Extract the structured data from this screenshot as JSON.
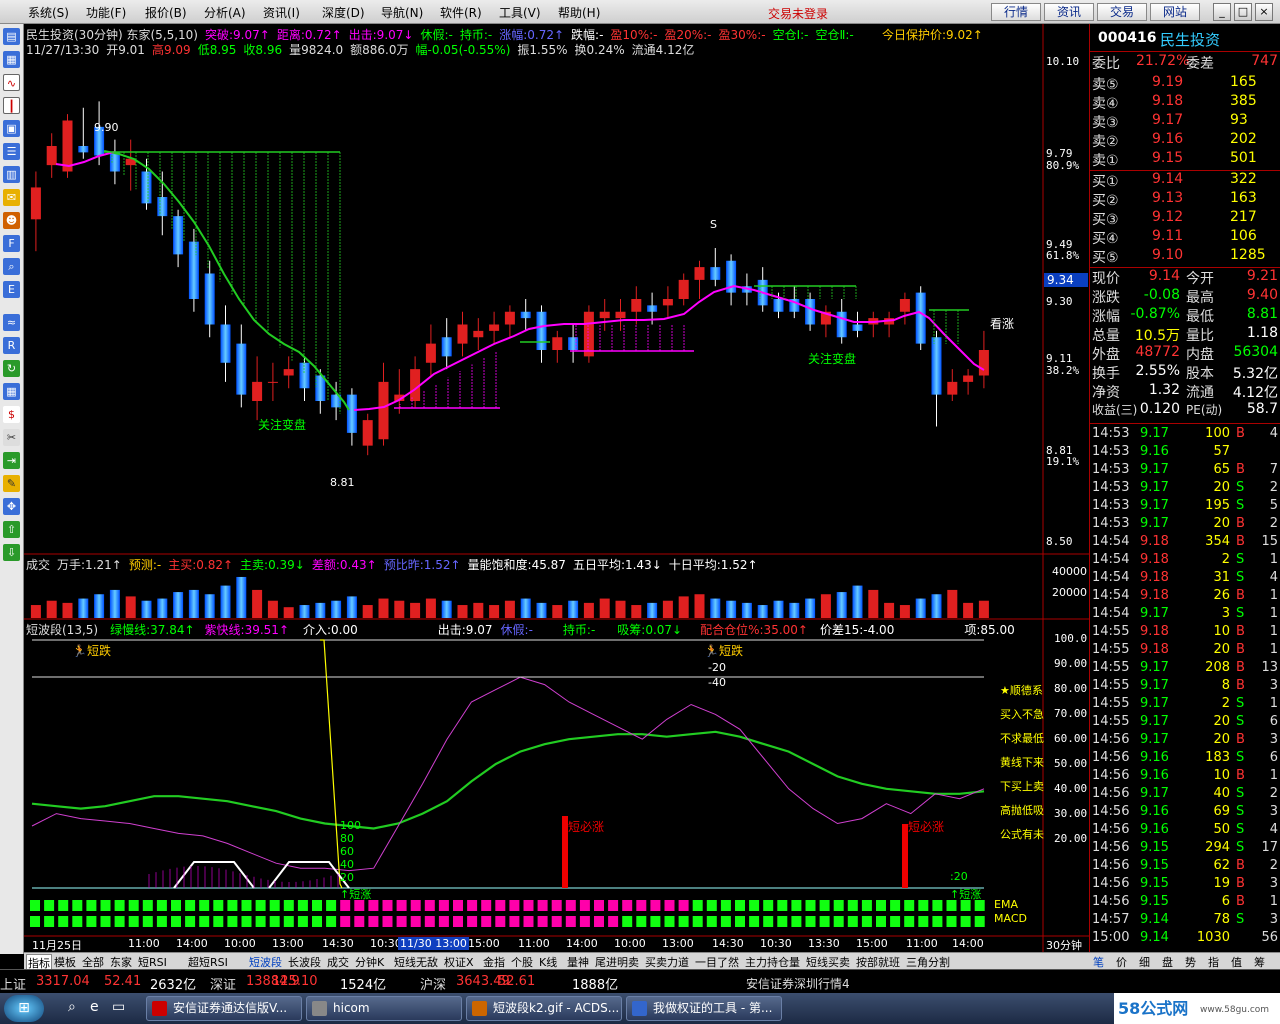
{
  "menu": {
    "items": [
      "系统(S)",
      "功能(F)",
      "报价(B)",
      "分析(A)",
      "资讯(I)",
      "深度(D)",
      "导航(N)",
      "软件(R)",
      "工具(V)",
      "帮助(H)"
    ],
    "login_status": "交易未登录",
    "buttons": [
      "行情",
      "资讯",
      "交易",
      "网站"
    ]
  },
  "window_buttons": [
    "_",
    "□",
    "×"
  ],
  "header": {
    "line1": [
      {
        "t": "民生投资(30分钟) 东家(5,5,10)",
        "c": "#ddd"
      },
      {
        "t": "突破:9.07↑",
        "c": "#f0f"
      },
      {
        "t": "距离:0.72↑",
        "c": "#f0f"
      },
      {
        "t": "出击:9.07↓",
        "c": "#f0f"
      },
      {
        "t": "休假:-",
        "c": "#0f0"
      },
      {
        "t": "持币:-",
        "c": "#0f0"
      },
      {
        "t": "涨幅:0.72↑",
        "c": "#66f"
      },
      {
        "t": "跌幅:-",
        "c": "#fff"
      },
      {
        "t": "盈10%:-",
        "c": "#f33"
      },
      {
        "t": "盈20%:-",
        "c": "#f33"
      },
      {
        "t": "盈30%:-",
        "c": "#f33"
      },
      {
        "t": "空仓Ⅰ:-",
        "c": "#0f0"
      },
      {
        "t": "空仓Ⅱ:-",
        "c": "#0f0"
      }
    ],
    "protect": "今日保护价:9.02↑",
    "line2": [
      {
        "t": "11/27/13:30",
        "c": "#ddd"
      },
      {
        "t": "开9.01",
        "c": "#ddd"
      },
      {
        "t": "高9.09",
        "c": "#f33"
      },
      {
        "t": "低8.95",
        "c": "#0f0"
      },
      {
        "t": "收8.96",
        "c": "#0f0"
      },
      {
        "t": "量9824.0",
        "c": "#ddd"
      },
      {
        "t": "额886.0万",
        "c": "#ddd"
      },
      {
        "t": "幅-0.05(-0.55%)",
        "c": "#0f0"
      },
      {
        "t": "振1.55%",
        "c": "#ddd"
      },
      {
        "t": "换0.24%",
        "c": "#ddd"
      },
      {
        "t": "流通4.12亿",
        "c": "#ddd"
      }
    ]
  },
  "price_axis": {
    "labels": [
      {
        "v": "10.10",
        "y": 38
      },
      {
        "v": "9.79",
        "y": 130
      },
      {
        "v": "80.9%",
        "y": 142
      },
      {
        "v": "9.49",
        "y": 221
      },
      {
        "v": "61.8%",
        "y": 232
      },
      {
        "v": "9.34",
        "y": 256
      },
      {
        "v": "9.30",
        "y": 278
      },
      {
        "v": "9.11",
        "y": 335
      },
      {
        "v": "38.2%",
        "y": 347
      },
      {
        "v": "8.81",
        "y": 427
      },
      {
        "v": "19.1%",
        "y": 438
      },
      {
        "v": "8.50",
        "y": 518
      }
    ],
    "current": "9.34"
  },
  "annotations": {
    "high": "9.90",
    "low": "8.81",
    "s_mark": "S",
    "watch1": "关注变盘",
    "watch2": "关注变盘",
    "kanzhang": "看涨"
  },
  "volume": {
    "header": [
      {
        "t": "成交",
        "c": "#ddd"
      },
      {
        "t": "万手:1.21↑",
        "c": "#ddd"
      },
      {
        "t": "预测:-",
        "c": "#fc0"
      },
      {
        "t": "主买:0.82↑",
        "c": "#f33"
      },
      {
        "t": "主卖:0.39↓",
        "c": "#0f0"
      },
      {
        "t": "差额:0.43↑",
        "c": "#f0f"
      },
      {
        "t": "预比昨:1.52↑",
        "c": "#66f"
      },
      {
        "t": "量能饱和度:45.87",
        "c": "#fff"
      },
      {
        "t": "五日平均:1.43↓",
        "c": "#fff"
      },
      {
        "t": "十日平均:1.52↑",
        "c": "#fff"
      }
    ],
    "axis": [
      "40000",
      "20000"
    ]
  },
  "indicator": {
    "header": [
      {
        "t": "短波段(13,5)",
        "c": "#ddd"
      },
      {
        "t": "绿慢线:37.84↑",
        "c": "#0f0"
      },
      {
        "t": "紫快线:39.51↑",
        "c": "#f0f"
      },
      {
        "t": "介入:0.00",
        "c": "#fff"
      },
      {
        "t": "出击:9.07",
        "c": "#fff"
      },
      {
        "t": "休假:-",
        "c": "#66f"
      },
      {
        "t": "持币:-",
        "c": "#0f0"
      },
      {
        "t": "吸筹:0.07↓",
        "c": "#0f0"
      },
      {
        "t": "配合仓位%:35.00↑",
        "c": "#f33"
      },
      {
        "t": "价差15:-4.00",
        "c": "#fff"
      },
      {
        "t": "项:85.00",
        "c": "#fff"
      }
    ],
    "axis": [
      "100.0",
      "90.00",
      "80.00",
      "70.00",
      "60.00",
      "50.00",
      "40.00",
      "30.00",
      "20.00"
    ],
    "legend": [
      "★顺德系",
      "买入不急",
      "不求最低",
      "黄线下来",
      "下买上卖",
      "高抛低吸",
      "公式有未"
    ],
    "labels": {
      "duandie1": "短跌",
      "duandie2": "短跌",
      "bizhang1": "短必涨",
      "bizhang2": "短必涨",
      "n100": "100",
      "n80": "80",
      "n60": "60",
      "n40": "40",
      "n20": "20",
      "m20": "-20",
      "m40": "-40",
      "duanzhang1": "短涨",
      "duanzhang2": "短涨",
      "k20": ":20",
      "ema": "EMA",
      "macd": "MACD"
    }
  },
  "time_axis": {
    "labels": [
      "11月25日",
      "11:00",
      "14:00",
      "10:00",
      "13:00",
      "14:30",
      "10:30",
      "11/30 13:00",
      "15:00",
      "11:00",
      "14:00",
      "10:00",
      "13:00",
      "14:30",
      "10:30",
      "13:30",
      "15:00",
      "11:00",
      "14:00"
    ],
    "period": "30分钟"
  },
  "bottom_tabs": [
    "指标",
    "模板",
    "全部",
    "东家",
    "短RSI",
    "超短RSI",
    "短波段",
    "长波段",
    "成交",
    "分钟K",
    "短线无敌",
    "权证X",
    "金指",
    "个股",
    "K线",
    "量神",
    "尾进明卖",
    "买卖力道",
    "一目了然",
    "主力持仓量",
    "短线买卖",
    "按部就班",
    "三角分割"
  ],
  "right_tabs": [
    "笔",
    "价",
    "细",
    "盘",
    "势",
    "指",
    "值",
    "筹"
  ],
  "quote": {
    "code": "000416",
    "name": "民生投资",
    "weibi": {
      "l": "委比",
      "v": "21.72%",
      "l2": "委差",
      "v2": "747"
    },
    "sell": [
      {
        "l": "卖⑤",
        "p": "9.19",
        "v": "165"
      },
      {
        "l": "卖④",
        "p": "9.18",
        "v": "385"
      },
      {
        "l": "卖③",
        "p": "9.17",
        "v": "93"
      },
      {
        "l": "卖②",
        "p": "9.16",
        "v": "202"
      },
      {
        "l": "卖①",
        "p": "9.15",
        "v": "501"
      }
    ],
    "buy": [
      {
        "l": "买①",
        "p": "9.14",
        "v": "322"
      },
      {
        "l": "买②",
        "p": "9.13",
        "v": "163"
      },
      {
        "l": "买③",
        "p": "9.12",
        "v": "217"
      },
      {
        "l": "买④",
        "p": "9.11",
        "v": "106"
      },
      {
        "l": "买⑤",
        "p": "9.10",
        "v": "1285"
      }
    ],
    "stats": [
      {
        "l1": "现价",
        "v1": "9.14",
        "c1": "#f33",
        "l2": "今开",
        "v2": "9.21",
        "c2": "#f33"
      },
      {
        "l1": "涨跌",
        "v1": "-0.08",
        "c1": "#0f0",
        "l2": "最高",
        "v2": "9.40",
        "c2": "#f33"
      },
      {
        "l1": "涨幅",
        "v1": "-0.87%",
        "c1": "#0f0",
        "l2": "最低",
        "v2": "8.81",
        "c2": "#0f0"
      },
      {
        "l1": "总量",
        "v1": "10.5万",
        "c1": "#ff0",
        "l2": "量比",
        "v2": "1.18",
        "c2": "#fff"
      },
      {
        "l1": "外盘",
        "v1": "48772",
        "c1": "#f33",
        "l2": "内盘",
        "v2": "56304",
        "c2": "#0f0"
      },
      {
        "l1": "换手",
        "v1": "2.55%",
        "c1": "#fff",
        "l2": "股本",
        "v2": "5.32亿",
        "c2": "#fff"
      },
      {
        "l1": "净资",
        "v1": "1.32",
        "c1": "#fff",
        "l2": "流通",
        "v2": "4.12亿",
        "c2": "#fff"
      },
      {
        "l1": "收益(三)",
        "v1": "0.120",
        "c1": "#fff",
        "l2": "PE(动)",
        "v2": "58.7",
        "c2": "#fff"
      }
    ]
  },
  "ticks": [
    [
      "14:53",
      "9.17",
      "100",
      "B",
      "4"
    ],
    [
      "14:53",
      "9.16",
      "57",
      "",
      ""
    ],
    [
      "14:53",
      "9.17",
      "65",
      "B",
      "7"
    ],
    [
      "14:53",
      "9.17",
      "20",
      "S",
      "2"
    ],
    [
      "14:53",
      "9.17",
      "195",
      "S",
      "5"
    ],
    [
      "14:53",
      "9.17",
      "20",
      "B",
      "2"
    ],
    [
      "14:54",
      "9.18",
      "354",
      "B",
      "15"
    ],
    [
      "14:54",
      "9.18",
      "2",
      "S",
      "1"
    ],
    [
      "14:54",
      "9.18",
      "31",
      "S",
      "4"
    ],
    [
      "14:54",
      "9.18",
      "26",
      "B",
      "1"
    ],
    [
      "14:54",
      "9.17",
      "3",
      "S",
      "1"
    ],
    [
      "14:55",
      "9.18",
      "10",
      "B",
      "1"
    ],
    [
      "14:55",
      "9.18",
      "20",
      "B",
      "1"
    ],
    [
      "14:55",
      "9.17",
      "208",
      "B",
      "13"
    ],
    [
      "14:55",
      "9.17",
      "8",
      "B",
      "3"
    ],
    [
      "14:55",
      "9.17",
      "2",
      "S",
      "1"
    ],
    [
      "14:55",
      "9.17",
      "20",
      "S",
      "6"
    ],
    [
      "14:56",
      "9.17",
      "20",
      "B",
      "3"
    ],
    [
      "14:56",
      "9.16",
      "183",
      "S",
      "6"
    ],
    [
      "14:56",
      "9.16",
      "10",
      "B",
      "1"
    ],
    [
      "14:56",
      "9.17",
      "40",
      "S",
      "2"
    ],
    [
      "14:56",
      "9.16",
      "69",
      "S",
      "3"
    ],
    [
      "14:56",
      "9.16",
      "50",
      "S",
      "4"
    ],
    [
      "14:56",
      "9.15",
      "294",
      "S",
      "17"
    ],
    [
      "14:56",
      "9.15",
      "62",
      "B",
      "2"
    ],
    [
      "14:56",
      "9.15",
      "19",
      "B",
      "3"
    ],
    [
      "14:56",
      "9.15",
      "6",
      "B",
      "1"
    ],
    [
      "14:57",
      "9.14",
      "78",
      "S",
      "3"
    ],
    [
      "15:00",
      "9.14",
      "1030",
      "",
      "56"
    ]
  ],
  "index_bar": {
    "items": [
      {
        "l": "上证",
        "v": "3317.04",
        "c": "#f33"
      },
      {
        "l": "",
        "v": "52.41",
        "c": "#f33"
      },
      {
        "l": "",
        "v": "2632亿",
        "c": "#fff"
      },
      {
        "l": "深证",
        "v": "13884.9",
        "c": "#f33"
      },
      {
        "l": "",
        "v": "125.10",
        "c": "#f33"
      },
      {
        "l": "",
        "v": "1524亿",
        "c": "#fff"
      },
      {
        "l": "沪深",
        "v": "3643.49",
        "c": "#f33"
      },
      {
        "l": "",
        "v": "52.61",
        "c": "#f33"
      },
      {
        "l": "",
        "v": "1888亿",
        "c": "#fff"
      }
    ],
    "status": "安信证券深圳行情4"
  },
  "taskbar": {
    "items": [
      "安信证券通达信版V...",
      "hicom",
      "短波段k2.gif - ACDS...",
      "我做权证的工具 - 第..."
    ],
    "watermark": "58公式网",
    "watermark_url": "www.58gu.com"
  },
  "chart_data": [
    {
      "type": "candlestick",
      "title": "民生投资(30分钟)",
      "ylim": [
        8.5,
        10.1
      ],
      "ohlc": [
        [
          9.55,
          9.7,
          9.45,
          9.65
        ],
        [
          9.72,
          9.82,
          9.68,
          9.78
        ],
        [
          9.7,
          9.88,
          9.68,
          9.86
        ],
        [
          9.78,
          9.9,
          9.74,
          9.76
        ],
        [
          9.84,
          9.92,
          9.72,
          9.75
        ],
        [
          9.76,
          9.8,
          9.66,
          9.7
        ],
        [
          9.72,
          9.8,
          9.64,
          9.74
        ],
        [
          9.7,
          9.74,
          9.58,
          9.6
        ],
        [
          9.62,
          9.7,
          9.5,
          9.56
        ],
        [
          9.56,
          9.58,
          9.4,
          9.44
        ],
        [
          9.48,
          9.52,
          9.26,
          9.3
        ],
        [
          9.38,
          9.42,
          9.18,
          9.22
        ],
        [
          9.22,
          9.28,
          9.04,
          9.1
        ],
        [
          9.16,
          9.22,
          8.96,
          9.0
        ],
        [
          8.98,
          9.12,
          8.92,
          9.04
        ],
        [
          9.04,
          9.1,
          8.98,
          9.04
        ],
        [
          9.06,
          9.12,
          9.02,
          9.08
        ],
        [
          9.1,
          9.12,
          8.98,
          9.02
        ],
        [
          9.06,
          9.08,
          8.94,
          8.98
        ],
        [
          9.0,
          9.04,
          8.92,
          8.96
        ],
        [
          9.0,
          9.02,
          8.84,
          8.88
        ],
        [
          8.84,
          8.94,
          8.81,
          8.92
        ],
        [
          8.86,
          9.1,
          8.84,
          9.04
        ],
        [
          8.98,
          9.08,
          8.94,
          9.0
        ],
        [
          8.98,
          9.12,
          8.96,
          9.08
        ],
        [
          9.1,
          9.22,
          9.06,
          9.16
        ],
        [
          9.18,
          9.24,
          9.08,
          9.12
        ],
        [
          9.16,
          9.26,
          9.12,
          9.22
        ],
        [
          9.18,
          9.24,
          9.14,
          9.2
        ],
        [
          9.2,
          9.26,
          9.16,
          9.22
        ],
        [
          9.22,
          9.28,
          9.18,
          9.26
        ],
        [
          9.26,
          9.3,
          9.2,
          9.24
        ],
        [
          9.26,
          9.28,
          9.1,
          9.14
        ],
        [
          9.14,
          9.2,
          9.1,
          9.18
        ],
        [
          9.18,
          9.22,
          9.1,
          9.14
        ],
        [
          9.12,
          9.28,
          9.1,
          9.26
        ],
        [
          9.24,
          9.3,
          9.2,
          9.26
        ],
        [
          9.24,
          9.3,
          9.2,
          9.26
        ],
        [
          9.26,
          9.34,
          9.22,
          9.3
        ],
        [
          9.28,
          9.32,
          9.22,
          9.26
        ],
        [
          9.28,
          9.34,
          9.24,
          9.3
        ],
        [
          9.3,
          9.38,
          9.28,
          9.36
        ],
        [
          9.36,
          9.42,
          9.3,
          9.4
        ],
        [
          9.4,
          9.46,
          9.34,
          9.36
        ],
        [
          9.42,
          9.44,
          9.28,
          9.32
        ],
        [
          9.34,
          9.38,
          9.28,
          9.32
        ],
        [
          9.36,
          9.4,
          9.26,
          9.28
        ],
        [
          9.3,
          9.32,
          9.24,
          9.26
        ],
        [
          9.3,
          9.34,
          9.24,
          9.26
        ],
        [
          9.3,
          9.32,
          9.2,
          9.22
        ],
        [
          9.22,
          9.28,
          9.18,
          9.26
        ],
        [
          9.26,
          9.3,
          9.16,
          9.18
        ],
        [
          9.22,
          9.26,
          9.18,
          9.2
        ],
        [
          9.22,
          9.26,
          9.18,
          9.24
        ],
        [
          9.22,
          9.26,
          9.18,
          9.24
        ],
        [
          9.26,
          9.32,
          9.22,
          9.3
        ],
        [
          9.32,
          9.34,
          9.14,
          9.16
        ],
        [
          9.18,
          9.2,
          8.9,
          9.0
        ],
        [
          9.0,
          9.08,
          8.98,
          9.04
        ],
        [
          9.04,
          9.08,
          9.0,
          9.06
        ],
        [
          9.06,
          9.2,
          9.02,
          9.14
        ]
      ]
    },
    {
      "type": "bar",
      "title": "成交",
      "ylim": [
        0,
        50000
      ],
      "values": [
        12000,
        16000,
        14000,
        18000,
        22000,
        26000,
        20000,
        16000,
        18000,
        24000,
        26000,
        22000,
        30000,
        38000,
        26000,
        16000,
        10000,
        12000,
        14000,
        16000,
        20000,
        12000,
        18000,
        16000,
        14000,
        18000,
        16000,
        12000,
        14000,
        12000,
        16000,
        18000,
        14000,
        12000,
        16000,
        14000,
        18000,
        16000,
        12000,
        14000,
        16000,
        20000,
        22000,
        18000,
        16000,
        14000,
        12000,
        16000,
        14000,
        18000,
        22000,
        24000,
        30000,
        26000,
        14000,
        12000,
        18000,
        22000,
        26000,
        14000,
        16000
      ]
    },
    {
      "type": "line",
      "title": "短波段(13,5)",
      "ylim": [
        0,
        100
      ],
      "series": [
        {
          "name": "绿慢线",
          "values": [
            34,
            33,
            32,
            33,
            35,
            37,
            37,
            36,
            35,
            33,
            31,
            28,
            26,
            25,
            24,
            26,
            30,
            35,
            43,
            50,
            55,
            58,
            60,
            61,
            62,
            62,
            61,
            62,
            63,
            61,
            58,
            55,
            50,
            45,
            42,
            40,
            39,
            38,
            38,
            39
          ]
        },
        {
          "name": "紫快线",
          "values": [
            25,
            30,
            28,
            27,
            26,
            24,
            22,
            21,
            18,
            14,
            10,
            8,
            8,
            7,
            8,
            25,
            42,
            60,
            75,
            80,
            85,
            82,
            75,
            70,
            65,
            60,
            68,
            74,
            70,
            64,
            52,
            40,
            32,
            26,
            28,
            34,
            30,
            38,
            36,
            40
          ]
        }
      ]
    }
  ]
}
